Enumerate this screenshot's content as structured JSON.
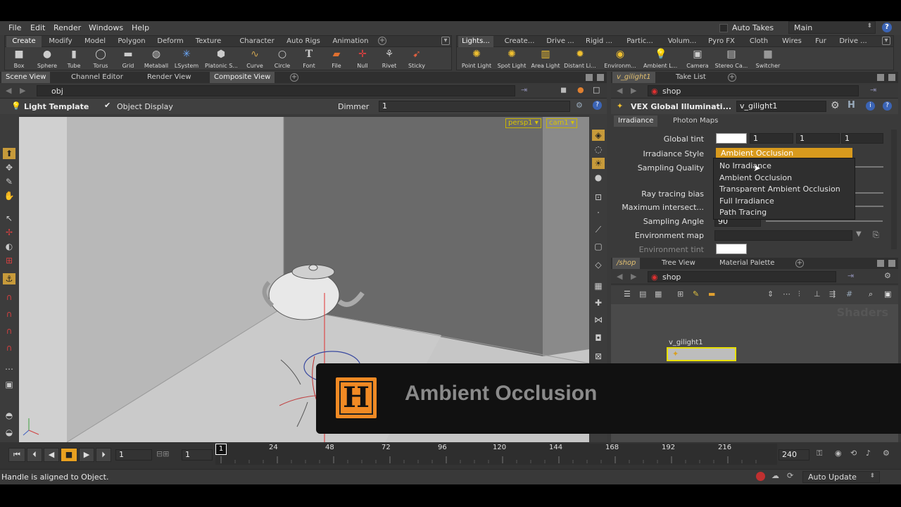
{
  "menu": {
    "file": "File",
    "edit": "Edit",
    "render": "Render",
    "windows": "Windows",
    "help": "Help"
  },
  "takes": {
    "label": "Auto Takes",
    "desktop": "Main"
  },
  "shelf_left": {
    "tabs": [
      "Create",
      "Modify",
      "Model",
      "Polygon",
      "Deform",
      "Texture",
      "Character",
      "Auto Rigs",
      "Animation"
    ],
    "tools": [
      "Box",
      "Sphere",
      "Tube",
      "Torus",
      "Grid",
      "Metaball",
      "LSystem",
      "Platonic S...",
      "Curve",
      "Circle",
      "Font",
      "File",
      "Null",
      "Rivet",
      "Sticky"
    ]
  },
  "shelf_right": {
    "tabs": [
      "Lights...",
      "Create...",
      "Drive ...",
      "Rigid ...",
      "Partic...",
      "Volum...",
      "Pyro FX",
      "Cloth",
      "Wires",
      "Fur",
      "Drive ..."
    ],
    "tools": [
      "Point Light",
      "Spot Light",
      "Area Light",
      "Distant Li...",
      "Environm...",
      "Ambient L...",
      "Camera",
      "Stereo Ca...",
      "Switcher"
    ]
  },
  "viewer_tabs": [
    "Scene View",
    "Channel Editor",
    "Render View",
    "Composite View"
  ],
  "viewer_path": "obj",
  "viewer_bar": {
    "template": "Light Template",
    "object_display": "Object Display",
    "dimmer_label": "Dimmer",
    "dimmer_value": "1"
  },
  "viewer_cams": {
    "persp": "persp1",
    "cam": "cam1"
  },
  "param_tabs": [
    "v_gilight1",
    "Take List"
  ],
  "param_path": "shop",
  "param_header": {
    "type": "VEX Global Illuminati...",
    "name": "v_gilight1"
  },
  "param_subtabs": [
    "Irradiance",
    "Photon Maps"
  ],
  "params": {
    "global_tint": "Global tint",
    "tint_values": [
      "1",
      "1",
      "1"
    ],
    "irradiance_style": "Irradiance Style",
    "sampling_quality": "Sampling Quality",
    "ray_bias": "Ray tracing bias",
    "max_intersect": "Maximum intersect...",
    "sampling_angle": "Sampling Angle",
    "sampling_angle_value": "90",
    "env_map": "Environment map",
    "env_tint": "Environment tint"
  },
  "dropdown": {
    "selected": "Ambient Occlusion",
    "options": [
      "No Irradiance",
      "Ambient Occlusion",
      "Transparent Ambient Occlusion",
      "Full Irradiance",
      "Path Tracing"
    ]
  },
  "net_tabs": [
    "/shop",
    "Tree View",
    "Material Palette"
  ],
  "net_path": "shop",
  "net_watermark": "Shaders",
  "net_node": "v_gilight1",
  "timeline": {
    "frame": "1",
    "start": "1",
    "current": "1",
    "end": "240",
    "ticks": [
      "24",
      "48",
      "72",
      "96",
      "120",
      "144",
      "168",
      "192",
      "216"
    ]
  },
  "status": {
    "message": "Handle is aligned to Object.",
    "update": "Auto Update"
  },
  "overlay": {
    "logo": "H",
    "text": "Ambient Occlusion"
  },
  "colors": {
    "accent": "#d89a1d",
    "logo": "#f08a24",
    "cam_label": "#d8c400"
  }
}
